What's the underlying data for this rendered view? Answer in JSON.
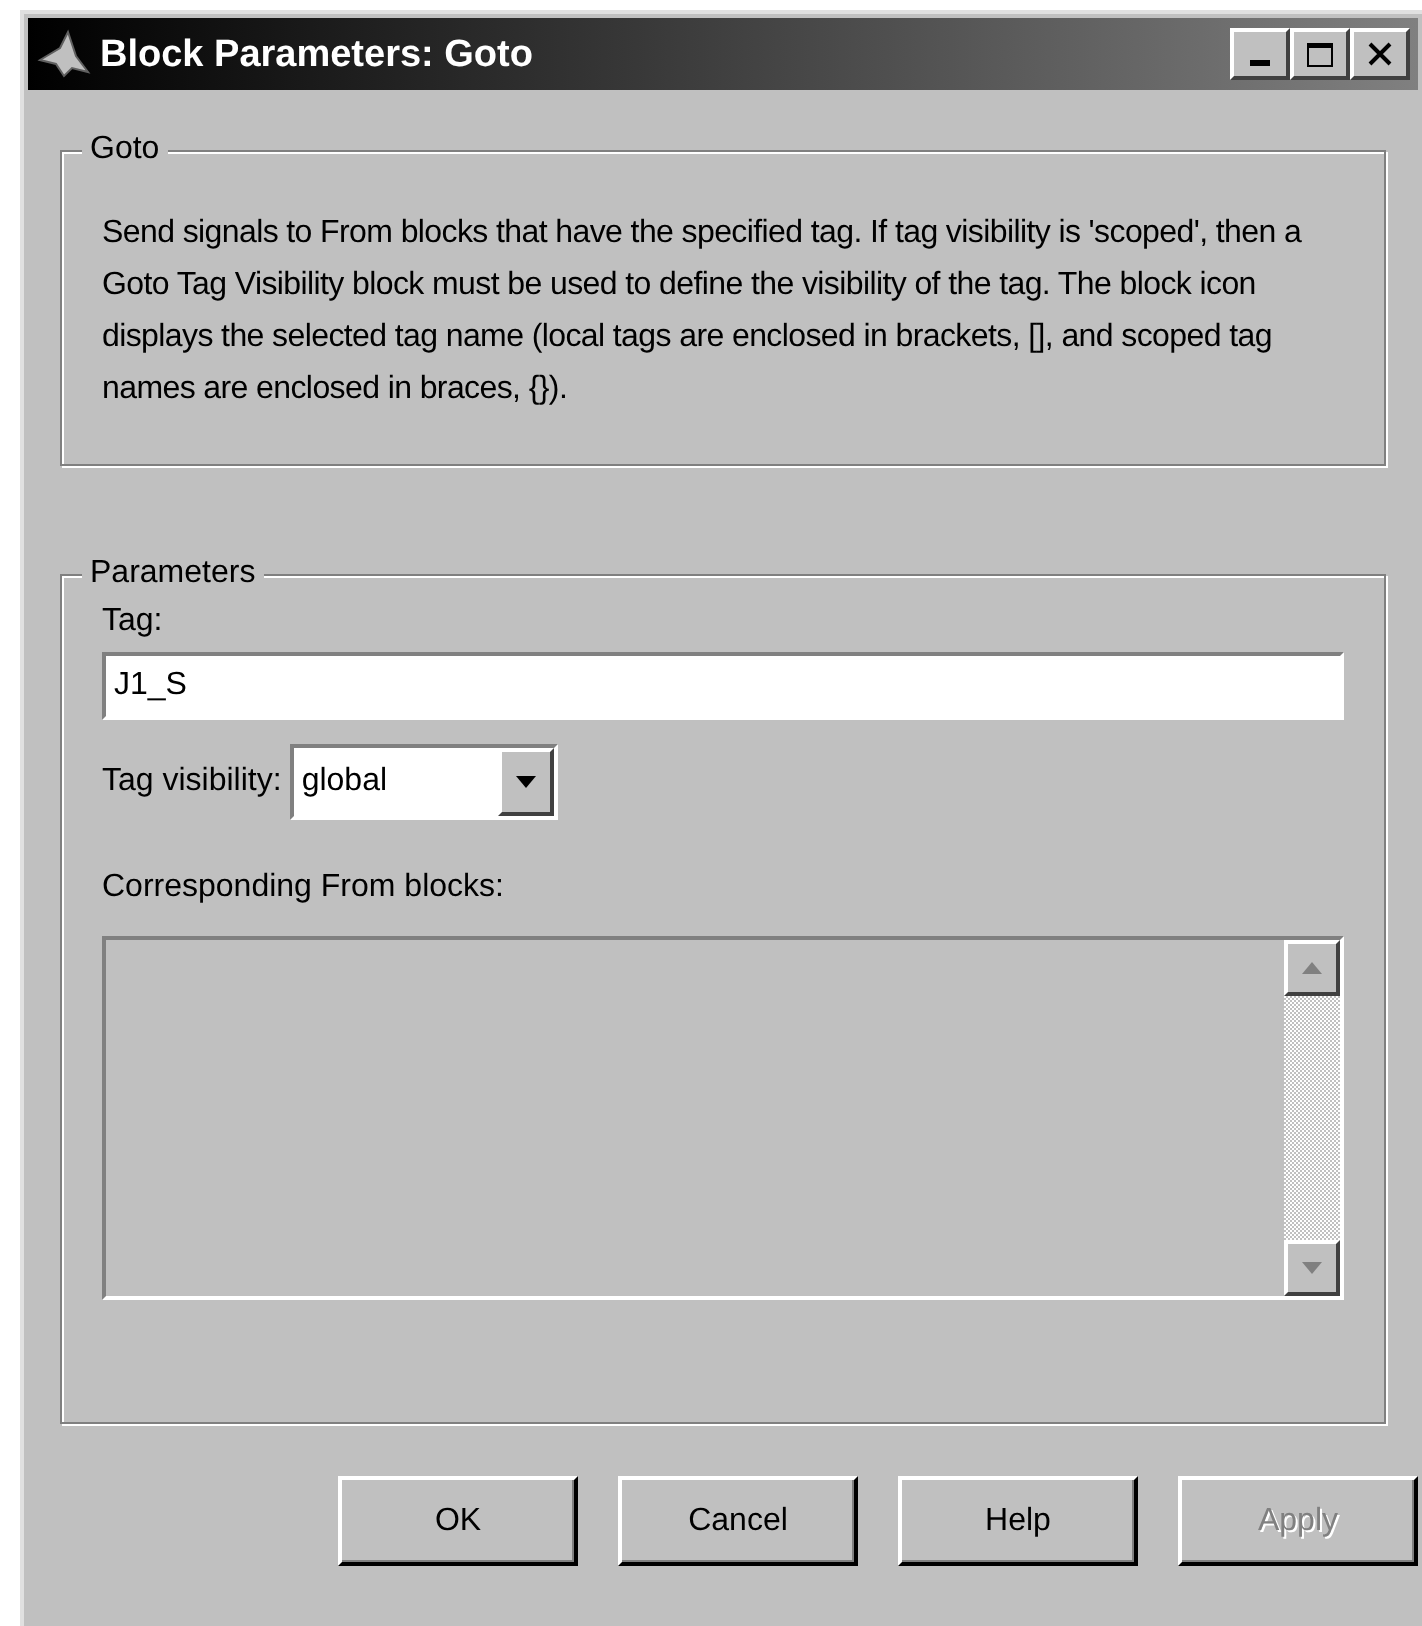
{
  "window": {
    "title": "Block Parameters: Goto"
  },
  "description_group": {
    "title": "Goto",
    "text": "Send signals to From blocks that have the specified tag. If tag visibility is 'scoped', then a Goto Tag Visibility block must be used to define the visibility of the tag. The block icon displays the selected tag name (local tags are enclosed in brackets, [], and scoped tag names are enclosed in braces, {})."
  },
  "parameters_group": {
    "title": "Parameters",
    "tag_label": "Tag:",
    "tag_value": "J1_S",
    "visibility_label": "Tag visibility:",
    "visibility_value": "global",
    "from_blocks_label": "Corresponding From blocks:"
  },
  "buttons": [
    {
      "label": "OK",
      "disabled": false
    },
    {
      "label": "Cancel",
      "disabled": false
    },
    {
      "label": "Help",
      "disabled": false
    },
    {
      "label": "Apply",
      "disabled": true
    }
  ]
}
